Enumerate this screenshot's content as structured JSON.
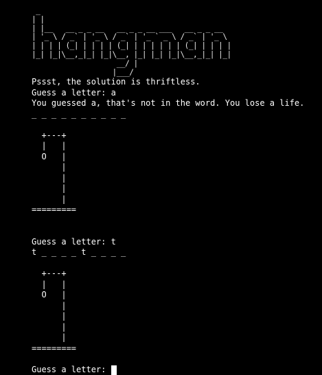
{
  "title_art": " _\n| |\n| |__   __ _ _ __   __ _ _ __ ___   __ _ _ __\n| '_ \\ / _` | '_ \\ / _` | '_ ` _ \\ / _` | '_ \\\n| | | | (_| | | | | (_| | | | | | | (_| | | | |\n|_| |_|\\__,_|_| |_|\\__, |_| |_| |_|\\__,_|_| |_|\n                    __/ |\n                   |___/",
  "hint_line": "Pssst, the solution is thriftless.",
  "round1": {
    "prompt": "Guess a letter: a",
    "feedback": "You guessed a, that's not in the word. You lose a life.",
    "word": "_ _ _ _ _ _ _ _ _ _",
    "gallows": "  +---+\n  |   |\n  O   |\n      |\n      |\n      |\n      |\n========="
  },
  "round2": {
    "prompt": "Guess a letter: t",
    "word": "t _ _ _ _ t _ _ _ _",
    "gallows": "  +---+\n  |   |\n  O   |\n      |\n      |\n      |\n      |\n========="
  },
  "current_prompt": "Guess a letter: "
}
